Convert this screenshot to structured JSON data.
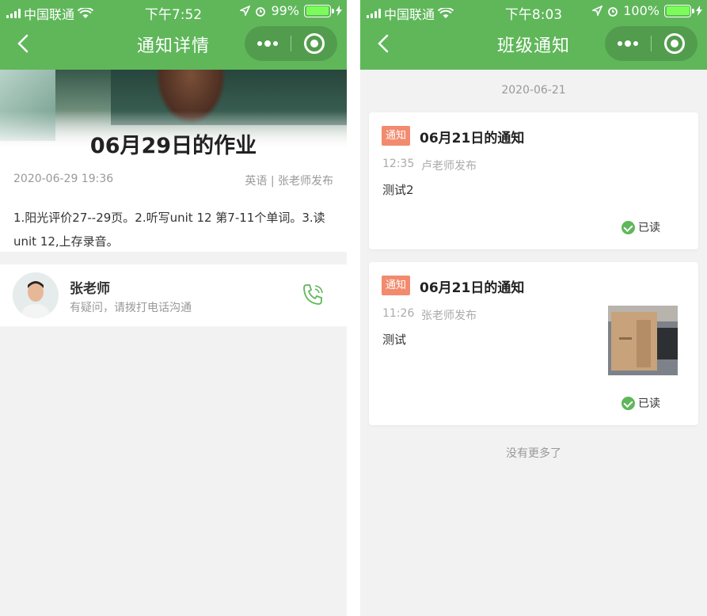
{
  "left": {
    "status": {
      "carrier": "中国联通",
      "time": "下午7:52",
      "battery": "99%",
      "battery_level": 0.99
    },
    "nav": {
      "title": "通知详情"
    },
    "detail": {
      "title": "06月29日的作业",
      "date": "2020-06-29 19:36",
      "publisher": "英语 | 张老师发布",
      "content": "1.阳光评价27--29页。2.听写unit 12 第7-11个单词。3.读unit 12,上存录音。"
    },
    "contact": {
      "name": "张老师",
      "hint": "有疑问，请拨打电话沟通"
    }
  },
  "right": {
    "status": {
      "carrier": "中国联通",
      "time": "下午8:03",
      "battery": "100%",
      "battery_level": 1.0
    },
    "nav": {
      "title": "班级通知"
    },
    "date": "2020-06-21",
    "notices": [
      {
        "tag": "通知",
        "title": "06月21日的通知",
        "time": "12:35",
        "publisher": "卢老师发布",
        "body": "测试2",
        "read": "已读"
      },
      {
        "tag": "通知",
        "title": "06月21日的通知",
        "time": "11:26",
        "publisher": "张老师发布",
        "body": "测试",
        "read": "已读"
      }
    ],
    "no_more": "没有更多了"
  },
  "theme": {
    "primary": "#5fb75a",
    "tag": "#f28b6e",
    "background": "#f2f2f2"
  },
  "icons": {
    "back": "chevron-left-icon",
    "more": "more-dots-icon",
    "close": "target-icon",
    "phone": "phone-icon",
    "read": "check-circle-icon"
  }
}
